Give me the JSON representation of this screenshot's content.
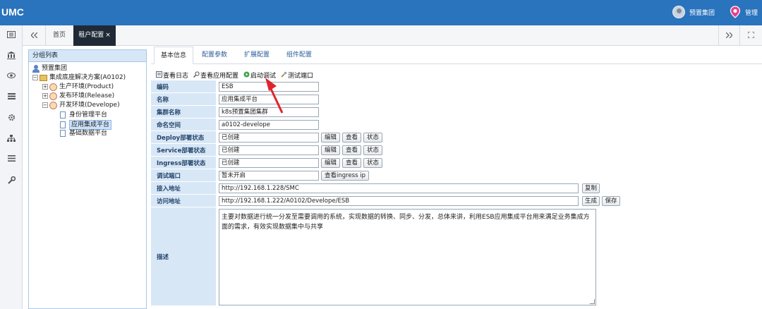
{
  "header": {
    "logo": "UMC",
    "org_name": "预置集团",
    "admin_name": "管理",
    "brand_color": "#2a73bd"
  },
  "tabs": {
    "home": "首页",
    "active": "租户配置",
    "close": "×"
  },
  "left_icons": [
    "grid-icon",
    "bank-icon",
    "eye-icon",
    "list-icon",
    "gear-icon",
    "sitemap-icon",
    "menu-icon",
    "wrench-icon"
  ],
  "tree": {
    "title": "分组列表",
    "nodes": [
      {
        "label": "预置集团"
      },
      {
        "label": "集成底座解决方案(A0102)"
      },
      {
        "label": "生产环境(Product)"
      },
      {
        "label": "发布环境(Release)"
      },
      {
        "label": "开发环境(Develope)"
      },
      {
        "label": "身份管理平台"
      },
      {
        "label": "应用集成平台"
      },
      {
        "label": "基础数据平台"
      }
    ]
  },
  "subtabs": [
    "基本信息",
    "配置参数",
    "扩展配置",
    "组件配置"
  ],
  "toolbar": {
    "view_log": "查看日志",
    "view_app_config": "查看应用配置",
    "start_debug": "启动调试",
    "test_port": "测试端口"
  },
  "form": {
    "code_label": "编码",
    "code_value": "ESB",
    "name_label": "名称",
    "name_value": "应用集成平台",
    "cluster_label": "集群名称",
    "cluster_value": "k8s预置集团集群",
    "namespace_label": "命名空间",
    "namespace_value": "a0102-develope",
    "deploy_label": "Deploy部署状态",
    "deploy_value": "已创建",
    "service_label": "Service部署状态",
    "service_value": "已创建",
    "ingress_label": "Ingress部署状态",
    "ingress_value": "已创建",
    "debug_port_label": "调试端口",
    "debug_port_value": "暂未开启",
    "view_ingress_ip": "查看ingress ip",
    "access_label": "接入地址",
    "access_value": "http://192.168.1.228/SMC",
    "copy": "复制",
    "visit_label": "访问地址",
    "visit_value": "http://192.168.1.222/A0102/Develope/ESB",
    "generate": "生成",
    "save": "保存",
    "desc_label": "描述",
    "desc_value": "主要对数据进行统一分发至需要调用的系统，实现数据的转换、同步、分发，总体来讲，利用ESB应用集成平台用来满足业务集成方面的需求，有效实现数据集中与共享",
    "edit": "编辑",
    "view": "查看",
    "status": "状态"
  }
}
